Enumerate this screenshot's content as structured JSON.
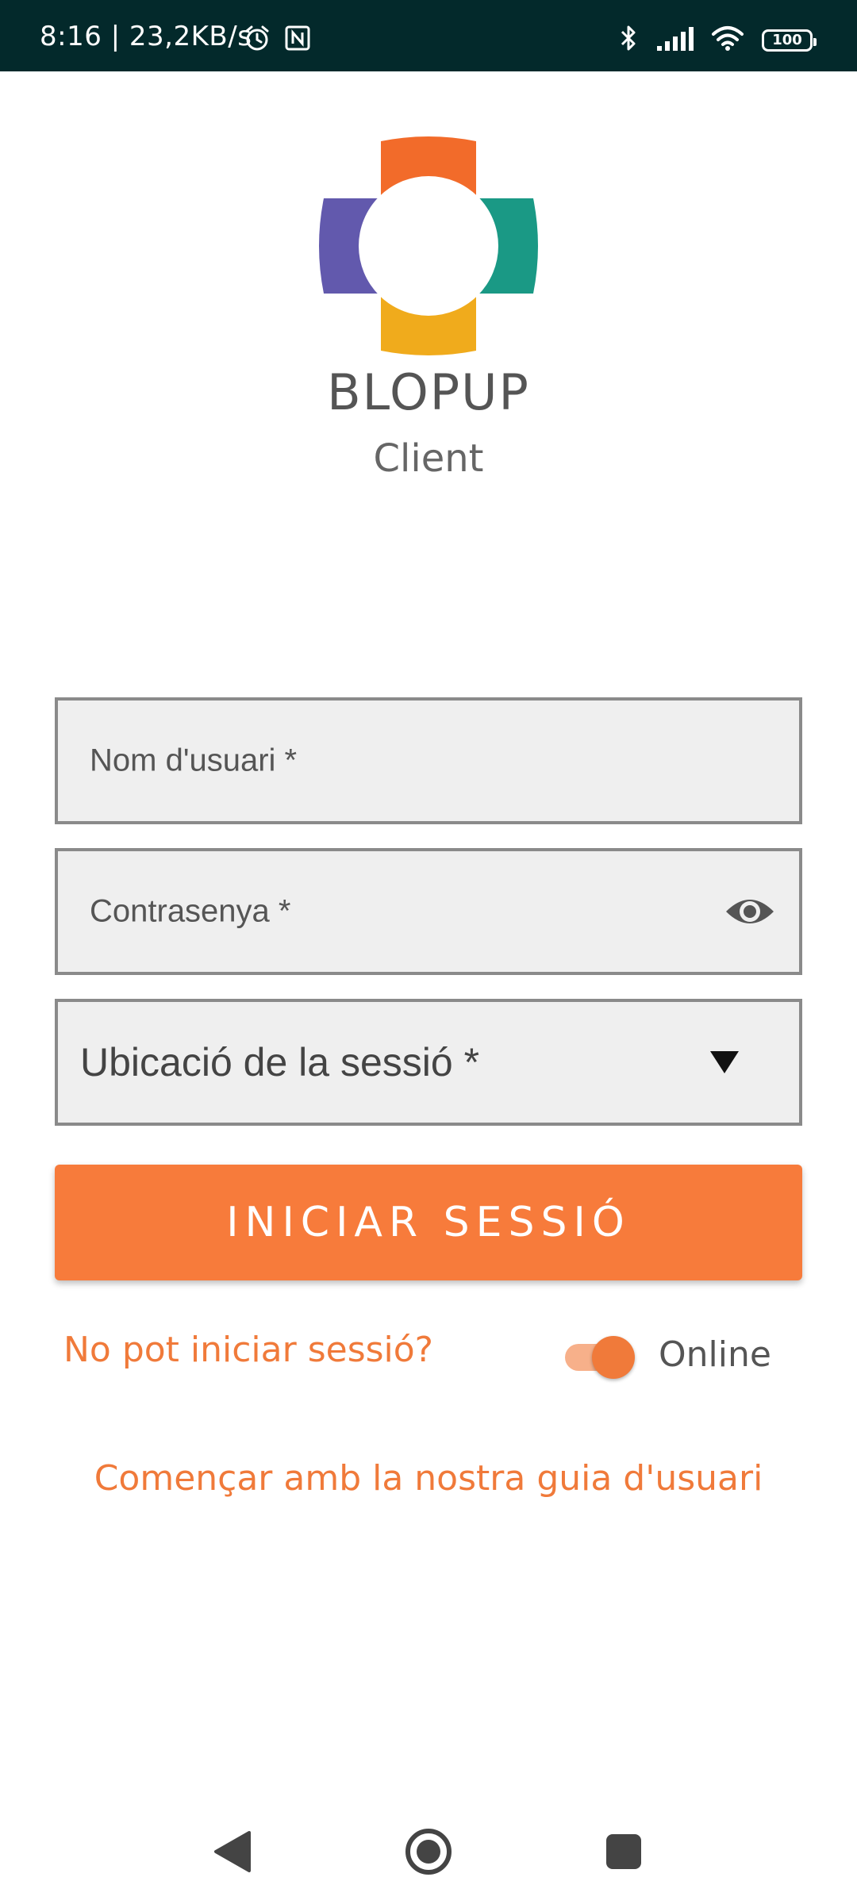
{
  "status_bar": {
    "time": "8:16 | 23,2KB/s",
    "battery": "100",
    "icons": [
      "alarm-icon",
      "nfc-icon",
      "bluetooth-icon",
      "signal-icon",
      "wifi-icon",
      "battery-icon"
    ]
  },
  "brand": {
    "name": "BLOPUP",
    "subtitle": "Client",
    "logo_colors": [
      "#f26b2a",
      "#1a9985",
      "#f0ab1c",
      "#6259ad"
    ]
  },
  "form": {
    "username_label": "Nom d'usuari *",
    "password_label": "Contrasenya *",
    "location_label": "Ubicació de la sessió *"
  },
  "actions": {
    "login_label": "INICIAR SESSIÓ",
    "forgot_label": "No pot iniciar sessió?",
    "online_label": "Online",
    "online_enabled": true,
    "guide_label": "Començar amb la nostra guia d'usuari"
  },
  "colors": {
    "accent": "#f77b3b",
    "status_bar": "#03292b"
  },
  "nav_bar": {
    "icons": [
      "back-icon",
      "home-icon",
      "recents-icon"
    ]
  }
}
